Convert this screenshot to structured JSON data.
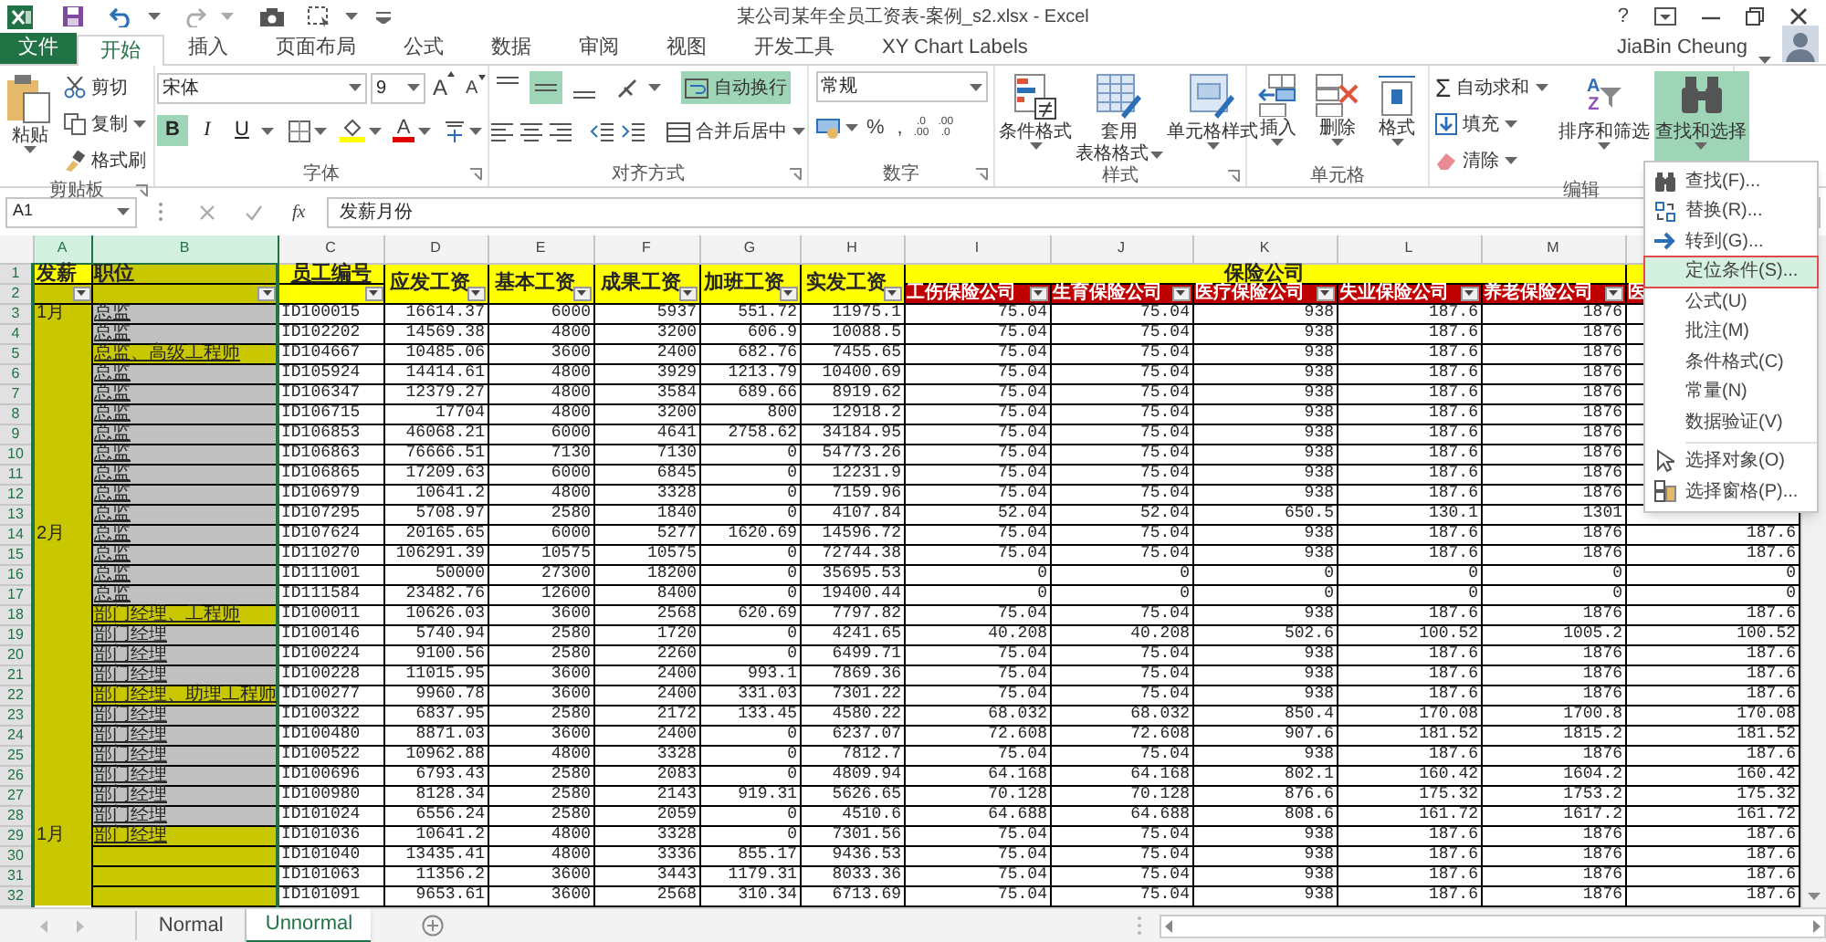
{
  "window": {
    "title": "某公司某年全员工资表-案例_s2.xlsx - Excel",
    "help": "?",
    "user": "JiaBin Cheung"
  },
  "tabs": [
    {
      "label": "文件",
      "kind": "file",
      "selected": false
    },
    {
      "label": "开始",
      "kind": "tab",
      "selected": true
    },
    {
      "label": "插入",
      "kind": "tab",
      "selected": false
    },
    {
      "label": "页面布局",
      "kind": "tab",
      "selected": false
    },
    {
      "label": "公式",
      "kind": "tab",
      "selected": false
    },
    {
      "label": "数据",
      "kind": "tab",
      "selected": false
    },
    {
      "label": "审阅",
      "kind": "tab",
      "selected": false
    },
    {
      "label": "视图",
      "kind": "tab",
      "selected": false
    },
    {
      "label": "开发工具",
      "kind": "tab",
      "selected": false
    },
    {
      "label": "XY Chart Labels",
      "kind": "tab",
      "selected": false
    }
  ],
  "ribbon": {
    "clipboard": {
      "label": "剪贴板",
      "paste": "粘贴",
      "items": [
        "剪切",
        "复制",
        "格式刷"
      ]
    },
    "font": {
      "label": "字体",
      "name": "宋体",
      "size": "9",
      "grow": "A",
      "shrink": "A",
      "styles": [
        {
          "label": "B",
          "selected": true
        },
        {
          "label": "I",
          "selected": false
        },
        {
          "label": "U",
          "selected": false
        }
      ],
      "font_color": "A"
    },
    "alignment": {
      "label": "对齐方式",
      "vertical": [
        {
          "selected": false
        },
        {
          "selected": true
        },
        {
          "selected": false
        }
      ],
      "wrap": {
        "label": "自动换行",
        "selected": true
      },
      "merge": "合并后居中"
    },
    "number": {
      "label": "数字",
      "format": "常规",
      "symbols": [
        "%",
        ","
      ],
      "decimals": [
        {
          "top": ".0",
          "bottom": ".00"
        },
        {
          "top": ".00",
          "bottom": ".0"
        }
      ]
    },
    "styles": {
      "label": "样式",
      "buttons": [
        [
          "条件格式"
        ],
        [
          "套用",
          "表格格式"
        ],
        [
          "单元格样式"
        ]
      ]
    },
    "cells": {
      "label": "单元格",
      "buttons": [
        "插入",
        "删除",
        "格式"
      ]
    },
    "editing": {
      "label": "编辑",
      "sigma": "Σ",
      "autosum": "自动求和",
      "fill": "填充",
      "clear": "清除",
      "sort": {
        "label": "排序和筛选",
        "letters": [
          "A",
          "Z"
        ]
      },
      "find": {
        "label": "查找和选择",
        "selected": true
      }
    }
  },
  "formula_bar": {
    "name_box": "A1",
    "fx": "fx",
    "value": "发薪月份"
  },
  "columns": [
    {
      "letter": "A",
      "selected": true
    },
    {
      "letter": "B",
      "selected": true
    },
    {
      "letter": "C",
      "selected": false
    },
    {
      "letter": "D",
      "selected": false
    },
    {
      "letter": "E",
      "selected": false
    },
    {
      "letter": "F",
      "selected": false
    },
    {
      "letter": "G",
      "selected": false
    },
    {
      "letter": "H",
      "selected": false
    },
    {
      "letter": "I",
      "selected": false
    },
    {
      "letter": "J",
      "selected": false
    },
    {
      "letter": "K",
      "selected": false
    },
    {
      "letter": "L",
      "selected": false
    },
    {
      "letter": "M",
      "selected": false
    }
  ],
  "header": {
    "rows": [
      "1",
      "2"
    ],
    "month": "发薪",
    "position": "职位",
    "id": "员工编号",
    "pay": [
      "应发工资",
      "基本工资",
      "成果工资",
      "加班工资",
      "实发工资"
    ],
    "group": "保险公司",
    "insurers": [
      "工伤保险公司",
      "生育保险公司",
      "医疗保险公司",
      "失业保险公司",
      "养老保险公司",
      "医"
    ]
  },
  "rows": [
    {
      "row": "3",
      "month": "1月",
      "position": "总监",
      "highlight": false,
      "cells": [
        "ID100015",
        "16614.37",
        "6000",
        "5937",
        "551.72",
        "11975.1",
        "75.04",
        "75.04",
        "938",
        "187.6",
        "1876"
      ]
    },
    {
      "row": "4",
      "position": "总监",
      "highlight": false,
      "cells": [
        "ID102202",
        "14569.38",
        "4800",
        "3200",
        "606.9",
        "10088.5",
        "75.04",
        "75.04",
        "938",
        "187.6",
        "1876"
      ]
    },
    {
      "row": "5",
      "position": "总监、高级工程师",
      "highlight": true,
      "cells": [
        "ID104667",
        "10485.06",
        "3600",
        "2400",
        "682.76",
        "7455.65",
        "75.04",
        "75.04",
        "938",
        "187.6",
        "1876"
      ]
    },
    {
      "row": "6",
      "position": "总监",
      "highlight": false,
      "cells": [
        "ID105924",
        "14414.61",
        "4800",
        "3929",
        "1213.79",
        "10400.69",
        "75.04",
        "75.04",
        "938",
        "187.6",
        "1876"
      ]
    },
    {
      "row": "7",
      "position": "总监",
      "highlight": false,
      "cells": [
        "ID106347",
        "12379.27",
        "4800",
        "3584",
        "689.66",
        "8919.62",
        "75.04",
        "75.04",
        "938",
        "187.6",
        "1876"
      ]
    },
    {
      "row": "8",
      "position": "总监",
      "highlight": false,
      "cells": [
        "ID106715",
        "17704",
        "4800",
        "3200",
        "800",
        "12918.2",
        "75.04",
        "75.04",
        "938",
        "187.6",
        "1876"
      ]
    },
    {
      "row": "9",
      "position": "总监",
      "highlight": false,
      "cells": [
        "ID106853",
        "46068.21",
        "6000",
        "4641",
        "2758.62",
        "34184.95",
        "75.04",
        "75.04",
        "938",
        "187.6",
        "1876"
      ]
    },
    {
      "row": "10",
      "position": "总监",
      "highlight": false,
      "cells": [
        "ID106863",
        "76666.51",
        "7130",
        "7130",
        "0",
        "54773.26",
        "75.04",
        "75.04",
        "938",
        "187.6",
        "1876"
      ]
    },
    {
      "row": "11",
      "position": "总监",
      "highlight": false,
      "cells": [
        "ID106865",
        "17209.63",
        "6000",
        "6845",
        "0",
        "12231.9",
        "75.04",
        "75.04",
        "938",
        "187.6",
        "1876"
      ]
    },
    {
      "row": "12",
      "position": "总监",
      "highlight": false,
      "cells": [
        "ID106979",
        "10641.2",
        "4800",
        "3328",
        "0",
        "7159.96",
        "75.04",
        "75.04",
        "938",
        "187.6",
        "1876"
      ]
    },
    {
      "row": "13",
      "position": "总监",
      "highlight": false,
      "cells": [
        "ID107295",
        "5708.97",
        "2580",
        "1840",
        "0",
        "4107.84",
        "52.04",
        "52.04",
        "650.5",
        "130.1",
        "1301"
      ]
    },
    {
      "row": "14",
      "month": "2月",
      "position": "总监",
      "highlight": false,
      "cells": [
        "ID107624",
        "20165.65",
        "6000",
        "5277",
        "1620.69",
        "14596.72",
        "75.04",
        "75.04",
        "938",
        "187.6",
        "1876"
      ],
      "n": "187.6"
    },
    {
      "row": "15",
      "position": "总监",
      "highlight": false,
      "cells": [
        "ID110270",
        "106291.39",
        "10575",
        "10575",
        "0",
        "72744.38",
        "75.04",
        "75.04",
        "938",
        "187.6",
        "1876"
      ],
      "n": "187.6"
    },
    {
      "row": "16",
      "position": "总监",
      "highlight": false,
      "cells": [
        "ID111001",
        "50000",
        "27300",
        "18200",
        "0",
        "35695.53",
        "0",
        "0",
        "0",
        "0",
        "0"
      ],
      "n": "0"
    },
    {
      "row": "17",
      "position": "总监",
      "highlight": false,
      "cells": [
        "ID111584",
        "23482.76",
        "12600",
        "8400",
        "0",
        "19400.44",
        "0",
        "0",
        "0",
        "0",
        "0"
      ],
      "n": "0"
    },
    {
      "row": "18",
      "position": "部门经理、工程师",
      "highlight": true,
      "cells": [
        "ID100011",
        "10626.03",
        "3600",
        "2568",
        "620.69",
        "7797.82",
        "75.04",
        "75.04",
        "938",
        "187.6",
        "1876"
      ],
      "n": "187.6"
    },
    {
      "row": "19",
      "position": "部门经理",
      "highlight": false,
      "cells": [
        "ID100146",
        "5740.94",
        "2580",
        "1720",
        "0",
        "4241.65",
        "40.208",
        "40.208",
        "502.6",
        "100.52",
        "1005.2"
      ],
      "n": "100.52"
    },
    {
      "row": "20",
      "position": "部门经理",
      "highlight": false,
      "cells": [
        "ID100224",
        "9100.56",
        "2580",
        "2260",
        "0",
        "6499.71",
        "75.04",
        "75.04",
        "938",
        "187.6",
        "1876"
      ],
      "n": "187.6"
    },
    {
      "row": "21",
      "position": "部门经理",
      "highlight": false,
      "cells": [
        "ID100228",
        "11015.95",
        "3600",
        "2400",
        "993.1",
        "7869.36",
        "75.04",
        "75.04",
        "938",
        "187.6",
        "1876"
      ],
      "n": "187.6"
    },
    {
      "row": "22",
      "position": "部门经理、助理工程师",
      "highlight": true,
      "cells": [
        "ID100277",
        "9960.78",
        "3600",
        "2400",
        "331.03",
        "7301.22",
        "75.04",
        "75.04",
        "938",
        "187.6",
        "1876"
      ],
      "n": "187.6"
    },
    {
      "row": "23",
      "position": "部门经理",
      "highlight": false,
      "cells": [
        "ID100322",
        "6837.95",
        "2580",
        "2172",
        "133.45",
        "4580.22",
        "68.032",
        "68.032",
        "850.4",
        "170.08",
        "1700.8"
      ],
      "n": "170.08"
    },
    {
      "row": "24",
      "position": "部门经理",
      "highlight": false,
      "cells": [
        "ID100480",
        "8871.03",
        "3600",
        "2400",
        "0",
        "6237.07",
        "72.608",
        "72.608",
        "907.6",
        "181.52",
        "1815.2"
      ],
      "n": "181.52"
    },
    {
      "row": "25",
      "position": "部门经理",
      "highlight": false,
      "cells": [
        "ID100522",
        "10962.88",
        "4800",
        "3328",
        "0",
        "7812.7",
        "75.04",
        "75.04",
        "938",
        "187.6",
        "1876"
      ],
      "n": "187.6"
    },
    {
      "row": "26",
      "position": "部门经理",
      "highlight": false,
      "cells": [
        "ID100696",
        "6793.43",
        "2580",
        "2083",
        "0",
        "4809.94",
        "64.168",
        "64.168",
        "802.1",
        "160.42",
        "1604.2"
      ],
      "n": "160.42"
    },
    {
      "row": "27",
      "position": "部门经理",
      "highlight": false,
      "cells": [
        "ID100980",
        "8128.34",
        "2580",
        "2143",
        "919.31",
        "5626.65",
        "70.128",
        "70.128",
        "876.6",
        "175.32",
        "1753.2"
      ],
      "n": "175.32"
    },
    {
      "row": "28",
      "position": "部门经理",
      "highlight": false,
      "cells": [
        "ID101024",
        "6556.24",
        "2580",
        "2059",
        "0",
        "4510.6",
        "64.688",
        "64.688",
        "808.6",
        "161.72",
        "1617.2"
      ],
      "n": "161.72"
    },
    {
      "row": "29",
      "month": "1月",
      "position": "部门经理",
      "highlight": true,
      "cells": [
        "ID101036",
        "10641.2",
        "4800",
        "3328",
        "0",
        "7301.56",
        "75.04",
        "75.04",
        "938",
        "187.6",
        "1876"
      ],
      "n": "187.6"
    },
    {
      "row": "30",
      "highlight": true,
      "cells": [
        "ID101040",
        "13435.41",
        "4800",
        "3336",
        "855.17",
        "9436.53",
        "75.04",
        "75.04",
        "938",
        "187.6",
        "1876"
      ],
      "n": "187.6"
    },
    {
      "row": "31",
      "highlight": true,
      "cells": [
        "ID101063",
        "11356.2",
        "3600",
        "3443",
        "1179.31",
        "8033.36",
        "75.04",
        "75.04",
        "938",
        "187.6",
        "1876"
      ],
      "n": "187.6"
    },
    {
      "row": "32",
      "highlight": true,
      "cells": [
        "ID101091",
        "9653.61",
        "3600",
        "2568",
        "310.34",
        "6713.69",
        "75.04",
        "75.04",
        "938",
        "187.6",
        "1876"
      ],
      "n": "187.6"
    }
  ],
  "sheet_tabs": [
    {
      "label": "Normal",
      "selected": false
    },
    {
      "label": "Unnormal",
      "selected": true
    }
  ],
  "menu": {
    "items": [
      {
        "label": "查找(F)...",
        "selected": false
      },
      {
        "label": "替换(R)...",
        "selected": false
      },
      {
        "label": "转到(G)...",
        "selected": false
      },
      {
        "label": "定位条件(S)...",
        "selected": true
      },
      {
        "label": "公式(U)",
        "selected": false
      },
      {
        "label": "批注(M)",
        "selected": false
      },
      {
        "label": "条件格式(C)",
        "selected": false
      },
      {
        "label": "常量(N)",
        "selected": false
      },
      {
        "label": "数据验证(V)",
        "selected": false
      },
      {
        "label": "选择对象(O)",
        "selected": false
      },
      {
        "label": "选择窗格(P)...",
        "selected": false
      }
    ]
  }
}
